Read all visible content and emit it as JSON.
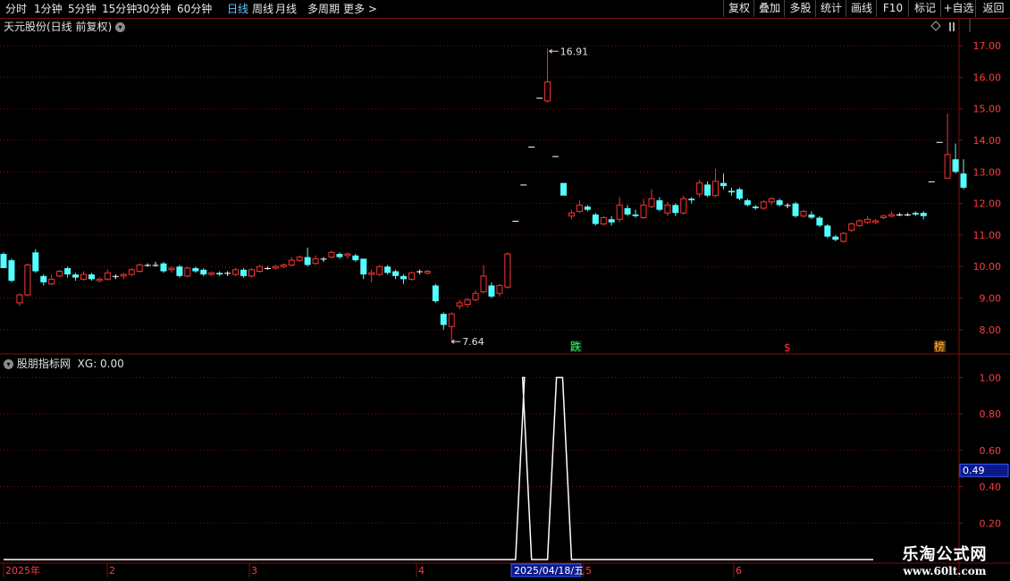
{
  "toolbar": {
    "tabs": [
      "分时",
      "1分钟",
      "5分钟",
      "15分钟",
      "30分钟",
      "60分钟",
      "日线",
      "周线",
      "月线",
      "多周期",
      "更多 >"
    ],
    "active_tab": "日线",
    "right_buttons": [
      "复权",
      "叠加",
      "多股",
      "统计",
      "画线",
      "F10",
      "标记",
      "+自选",
      "返回"
    ]
  },
  "main_title": "天元股份(日线 前复权)",
  "indicator_title": "股朋指标网",
  "indicator_value": "XG: 0.00",
  "price_axis": {
    "labels": [
      "17.00",
      "16.00",
      "15.00",
      "14.00",
      "13.00",
      "12.00",
      "11.00",
      "10.00",
      "9.00",
      "8.00"
    ]
  },
  "ind_axis": {
    "labels": [
      "1.00",
      "0.80",
      "0.60",
      "0.40",
      "0.20"
    ],
    "cursor_value": "0.49"
  },
  "annotations": {
    "high": "16.91",
    "low": "7.64"
  },
  "markers": {
    "die": "跌",
    "dollar": "$",
    "bang": "榜"
  },
  "date_axis": {
    "labels": [
      "2025年",
      "2",
      "3",
      "4",
      "2025/04/18/五",
      "5",
      "6"
    ]
  },
  "watermark": {
    "line1": "乐淘公式网",
    "line2": "www.60lt.com"
  },
  "colors": {
    "up": "#ff3232",
    "down": "#54ffff",
    "flat": "#ffffff",
    "grid": "#7a1010",
    "axis_text": "#ff3c3c"
  },
  "chart_data": {
    "type": "candlestick",
    "price_range": [
      7.4,
      17.4
    ],
    "candles": [
      [
        10.4,
        9.95,
        10.45,
        9.95
      ],
      [
        10.2,
        9.55,
        10.25,
        9.5
      ],
      [
        8.85,
        9.1,
        9.15,
        8.75
      ],
      [
        9.1,
        10.05,
        10.1,
        9.05
      ],
      [
        10.45,
        9.85,
        10.55,
        9.8
      ],
      [
        9.7,
        9.5,
        9.75,
        9.4
      ],
      [
        9.45,
        9.6,
        9.75,
        9.4
      ],
      [
        9.7,
        9.85,
        9.9,
        9.65
      ],
      [
        9.95,
        9.75,
        10.0,
        9.65
      ],
      [
        9.75,
        9.65,
        9.8,
        9.55
      ],
      [
        9.6,
        9.75,
        9.85,
        9.55
      ],
      [
        9.75,
        9.6,
        9.8,
        9.55
      ],
      [
        9.55,
        9.6,
        9.65,
        9.5
      ],
      [
        9.6,
        9.8,
        9.9,
        9.55
      ],
      [
        9.7,
        9.7,
        9.75,
        9.6
      ],
      [
        9.7,
        9.75,
        9.8,
        9.6
      ],
      [
        9.75,
        9.9,
        9.95,
        9.7
      ],
      [
        9.85,
        10.05,
        10.1,
        9.8
      ],
      [
        10.05,
        10.05,
        10.1,
        10.0
      ],
      [
        10.05,
        10.05,
        10.15,
        10.0
      ],
      [
        10.1,
        9.85,
        10.15,
        9.8
      ],
      [
        9.9,
        9.95,
        10.0,
        9.8
      ],
      [
        10.0,
        9.7,
        10.05,
        9.65
      ],
      [
        9.7,
        9.95,
        10.0,
        9.65
      ],
      [
        9.95,
        9.85,
        10.0,
        9.8
      ],
      [
        9.9,
        9.75,
        9.95,
        9.7
      ],
      [
        9.75,
        9.8,
        9.85,
        9.7
      ],
      [
        9.8,
        9.75,
        9.85,
        9.7
      ],
      [
        9.8,
        9.8,
        9.85,
        9.7
      ],
      [
        9.75,
        9.9,
        9.95,
        9.7
      ],
      [
        9.9,
        9.7,
        9.95,
        9.65
      ],
      [
        9.7,
        9.9,
        9.95,
        9.65
      ],
      [
        9.85,
        10.0,
        10.05,
        9.8
      ],
      [
        9.95,
        9.95,
        10.0,
        9.9
      ],
      [
        9.95,
        10.0,
        10.05,
        9.9
      ],
      [
        10.0,
        10.05,
        10.1,
        9.95
      ],
      [
        10.05,
        10.2,
        10.3,
        10.0
      ],
      [
        10.2,
        10.3,
        10.35,
        10.15
      ],
      [
        10.3,
        10.05,
        10.6,
        10.0
      ],
      [
        10.1,
        10.25,
        10.35,
        10.05
      ],
      [
        10.25,
        10.25,
        10.3,
        10.15
      ],
      [
        10.3,
        10.45,
        10.5,
        10.25
      ],
      [
        10.4,
        10.3,
        10.45,
        10.25
      ],
      [
        10.35,
        10.4,
        10.45,
        10.25
      ],
      [
        10.35,
        10.2,
        10.4,
        10.15
      ],
      [
        10.25,
        9.75,
        10.25,
        9.6
      ],
      [
        9.75,
        9.8,
        9.9,
        9.5
      ],
      [
        9.75,
        10.0,
        10.05,
        9.7
      ],
      [
        10.0,
        9.8,
        10.05,
        9.75
      ],
      [
        9.85,
        9.7,
        9.9,
        9.6
      ],
      [
        9.7,
        9.6,
        9.75,
        9.45
      ],
      [
        9.6,
        9.8,
        9.85,
        9.55
      ],
      [
        9.85,
        9.85,
        9.9,
        9.75
      ],
      [
        9.8,
        9.85,
        9.9,
        9.75
      ],
      [
        9.4,
        8.9,
        9.45,
        8.85
      ],
      [
        8.5,
        8.15,
        8.55,
        8.0
      ],
      [
        8.1,
        8.5,
        8.55,
        7.65
      ],
      [
        8.75,
        8.85,
        8.95,
        8.65
      ],
      [
        8.8,
        8.95,
        9.0,
        8.7
      ],
      [
        8.95,
        9.15,
        9.25,
        8.9
      ],
      [
        9.2,
        9.7,
        10.05,
        9.15
      ],
      [
        9.4,
        9.05,
        9.5,
        9.0
      ],
      [
        9.15,
        9.4,
        9.45,
        9.05
      ],
      [
        9.35,
        10.4,
        10.45,
        9.3
      ],
      [
        11.45,
        11.45,
        11.45,
        11.45
      ],
      [
        12.6,
        12.6,
        12.6,
        12.6
      ],
      [
        13.8,
        13.8,
        13.8,
        13.8
      ],
      [
        15.35,
        15.35,
        15.35,
        15.35
      ],
      [
        15.25,
        15.85,
        16.91,
        15.2
      ],
      [
        13.5,
        13.5,
        13.5,
        13.5
      ],
      [
        12.65,
        12.25,
        12.65,
        12.25
      ],
      [
        11.6,
        11.7,
        11.8,
        11.5
      ],
      [
        11.75,
        11.95,
        12.1,
        11.7
      ],
      [
        11.9,
        11.8,
        11.95,
        11.75
      ],
      [
        11.65,
        11.35,
        11.7,
        11.3
      ],
      [
        11.35,
        11.55,
        11.6,
        11.3
      ],
      [
        11.5,
        11.4,
        11.6,
        11.3
      ],
      [
        11.5,
        11.95,
        12.2,
        11.4
      ],
      [
        11.85,
        11.65,
        11.95,
        11.6
      ],
      [
        11.65,
        11.6,
        11.8,
        11.55
      ],
      [
        11.55,
        11.95,
        12.15,
        11.5
      ],
      [
        11.9,
        12.15,
        12.45,
        11.85
      ],
      [
        12.1,
        11.8,
        12.2,
        11.75
      ],
      [
        11.7,
        11.95,
        12.05,
        11.6
      ],
      [
        11.95,
        11.7,
        12.0,
        11.6
      ],
      [
        11.7,
        12.15,
        12.25,
        11.65
      ],
      [
        12.15,
        12.1,
        12.2,
        12.0
      ],
      [
        12.3,
        12.65,
        12.75,
        12.2
      ],
      [
        12.6,
        12.25,
        12.7,
        12.2
      ],
      [
        12.25,
        12.7,
        13.1,
        12.2
      ],
      [
        12.65,
        12.55,
        12.95,
        12.45
      ],
      [
        12.4,
        12.35,
        12.5,
        12.25
      ],
      [
        12.45,
        12.15,
        12.5,
        12.1
      ],
      [
        12.1,
        11.95,
        12.15,
        11.9
      ],
      [
        11.9,
        11.85,
        11.95,
        11.8
      ],
      [
        11.85,
        12.05,
        12.1,
        11.8
      ],
      [
        12.05,
        12.15,
        12.2,
        11.95
      ],
      [
        12.1,
        11.95,
        12.15,
        11.9
      ],
      [
        11.95,
        11.95,
        12.0,
        11.85
      ],
      [
        12.0,
        11.6,
        12.05,
        11.55
      ],
      [
        11.6,
        11.75,
        11.8,
        11.55
      ],
      [
        11.65,
        11.55,
        11.75,
        11.5
      ],
      [
        11.55,
        11.3,
        11.6,
        11.25
      ],
      [
        11.3,
        10.95,
        11.35,
        10.9
      ],
      [
        10.95,
        10.85,
        11.0,
        10.8
      ],
      [
        10.8,
        11.05,
        11.1,
        10.75
      ],
      [
        11.15,
        11.35,
        11.4,
        11.1
      ],
      [
        11.3,
        11.45,
        11.5,
        11.25
      ],
      [
        11.4,
        11.5,
        11.6,
        11.35
      ],
      [
        11.4,
        11.45,
        11.5,
        11.35
      ],
      [
        11.55,
        11.6,
        11.65,
        11.5
      ],
      [
        11.6,
        11.65,
        11.75,
        11.55
      ],
      [
        11.65,
        11.65,
        11.7,
        11.6
      ],
      [
        11.65,
        11.65,
        11.7,
        11.6
      ],
      [
        11.7,
        11.65,
        11.75,
        11.6
      ],
      [
        11.7,
        11.6,
        11.75,
        11.5
      ],
      [
        12.7,
        12.7,
        12.7,
        12.7
      ],
      [
        13.95,
        13.95,
        13.95,
        13.95
      ],
      [
        12.8,
        13.55,
        14.85,
        12.8
      ],
      [
        13.4,
        13.0,
        13.9,
        12.95
      ],
      [
        12.95,
        12.5,
        13.4,
        12.45
      ]
    ],
    "indicator": {
      "name": "XG",
      "range": [
        0,
        1.1
      ],
      "spikes": [
        {
          "start_index": 64,
          "end_index": 66,
          "value": 1.0
        },
        {
          "start_index": 68,
          "end_index": 71,
          "value": 1.0
        }
      ]
    }
  }
}
